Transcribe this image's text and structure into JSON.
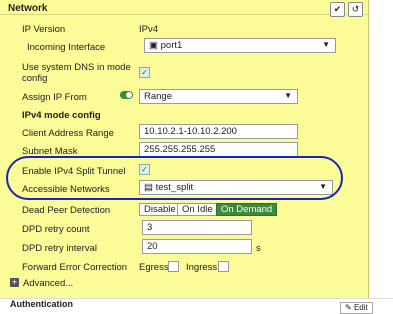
{
  "section_title": "Network",
  "header_icons": [
    "check-icon",
    "undo-icon"
  ],
  "ip_version": {
    "label": "IP Version",
    "value": "IPv4"
  },
  "incoming_interface": {
    "label": "Incoming Interface",
    "value": "port1"
  },
  "use_system_dns": {
    "label_line1": "Use system DNS in mode",
    "label_line2": "config",
    "checked": true
  },
  "assign_ip_from": {
    "label": "Assign IP From",
    "value": "Range",
    "toggle_on": true
  },
  "ipv4_mode_config": "IPv4 mode config",
  "client_address_range": {
    "label": "Client Address Range",
    "value": "10.10.2.1-10.10.2.200"
  },
  "subnet_mask": {
    "label": "Subnet Mask",
    "value": "255.255.255.255"
  },
  "split_tunnel": {
    "label": "Enable IPv4 Split Tunnel",
    "checked": true
  },
  "accessible_networks": {
    "label": "Accessible Networks",
    "value": "test_split"
  },
  "dead_peer_detection": {
    "label": "Dead Peer Detection",
    "options": [
      "Disable",
      "On Idle",
      "On Demand"
    ],
    "selected": "On Demand"
  },
  "dpd_retry_count": {
    "label": "DPD retry count",
    "value": "3"
  },
  "dpd_retry_interval": {
    "label": "DPD retry interval",
    "value": "20",
    "unit": "s"
  },
  "fec": {
    "label": "Forward Error Correction",
    "egress": "Egress",
    "ingress": "Ingress"
  },
  "advanced_label": "Advanced...",
  "next_section": "Authentication",
  "edit_label": "Edit",
  "colors": {
    "panel": "#fbfb98",
    "annotation": "#1b24b8",
    "active": "#3d8a3d"
  }
}
